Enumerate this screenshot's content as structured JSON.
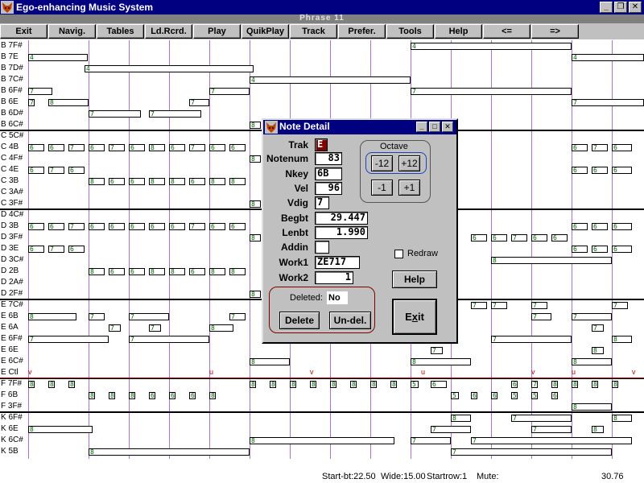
{
  "window": {
    "title": "Ego-enhancing Music System",
    "controls": [
      "_",
      "❐",
      "✕"
    ]
  },
  "phrase": "Phrase 11",
  "menu": [
    "Exit",
    "Navig.",
    "Tables",
    "Ld.Rcrd.",
    "Play",
    "QuikPlay",
    "Track",
    "Prefer.",
    "Tools",
    "Help",
    "<=",
    "=>"
  ],
  "rows": [
    "B 7F#",
    "B 7E",
    "B 7D#",
    "B 7C#",
    "B 6F#",
    "B 6E",
    "B 6D#",
    "B 6C#",
    "C 5C#",
    "C 4B",
    "C 4F#",
    "C 4E",
    "C 3B",
    "C 3A#",
    "C 3F#",
    "D 4C#",
    "D 3B",
    "D 3F#",
    "D 3E",
    "D 3C#",
    "D 2B",
    "D 2A#",
    "D 2F#",
    "E 7C#",
    "E 6B",
    "E 6A",
    "E 6F#",
    "E 6E",
    "E 6C#",
    "E Ctl",
    "F 7F#",
    "F 6B",
    "F 3F#",
    "K 6F#",
    "K 6E",
    "K 6C#",
    "K 5B"
  ],
  "status": {
    "startbt": "Start-bt:22.50",
    "wide": "Wide:15.00",
    "startrow": "Startrow:1",
    "mute": "Mute:",
    "value": "30.76"
  },
  "dialog": {
    "title": "Note Detail",
    "controls": [
      "_",
      "□",
      "✕"
    ],
    "fields": {
      "trak": {
        "label": "Trak",
        "value": "E"
      },
      "notenum": {
        "label": "Notenum",
        "value": "83"
      },
      "nkey": {
        "label": "Nkey",
        "value": "6B"
      },
      "vel": {
        "label": "Vel",
        "value": "96"
      },
      "vdig": {
        "label": "Vdig",
        "value": "7"
      },
      "begbt": {
        "label": "Begbt",
        "value": "29.447"
      },
      "lenbt": {
        "label": "Lenbt",
        "value": "1.990"
      },
      "addin": {
        "label": "Addin",
        "value": ""
      },
      "work1": {
        "label": "Work1",
        "value": "ZE717"
      },
      "work2": {
        "label": "Work2",
        "value": "1"
      }
    },
    "octave": {
      "label": "Octave",
      "buttons": [
        "-12",
        "+12",
        "-1",
        "+1"
      ]
    },
    "redraw": "Redraw",
    "help": "Help",
    "deleted_label": "Deleted:",
    "deleted_value": "No",
    "delete": "Delete",
    "undelete": "Un-del.",
    "exit": "Exit",
    "exit_mnemonic": "x"
  }
}
